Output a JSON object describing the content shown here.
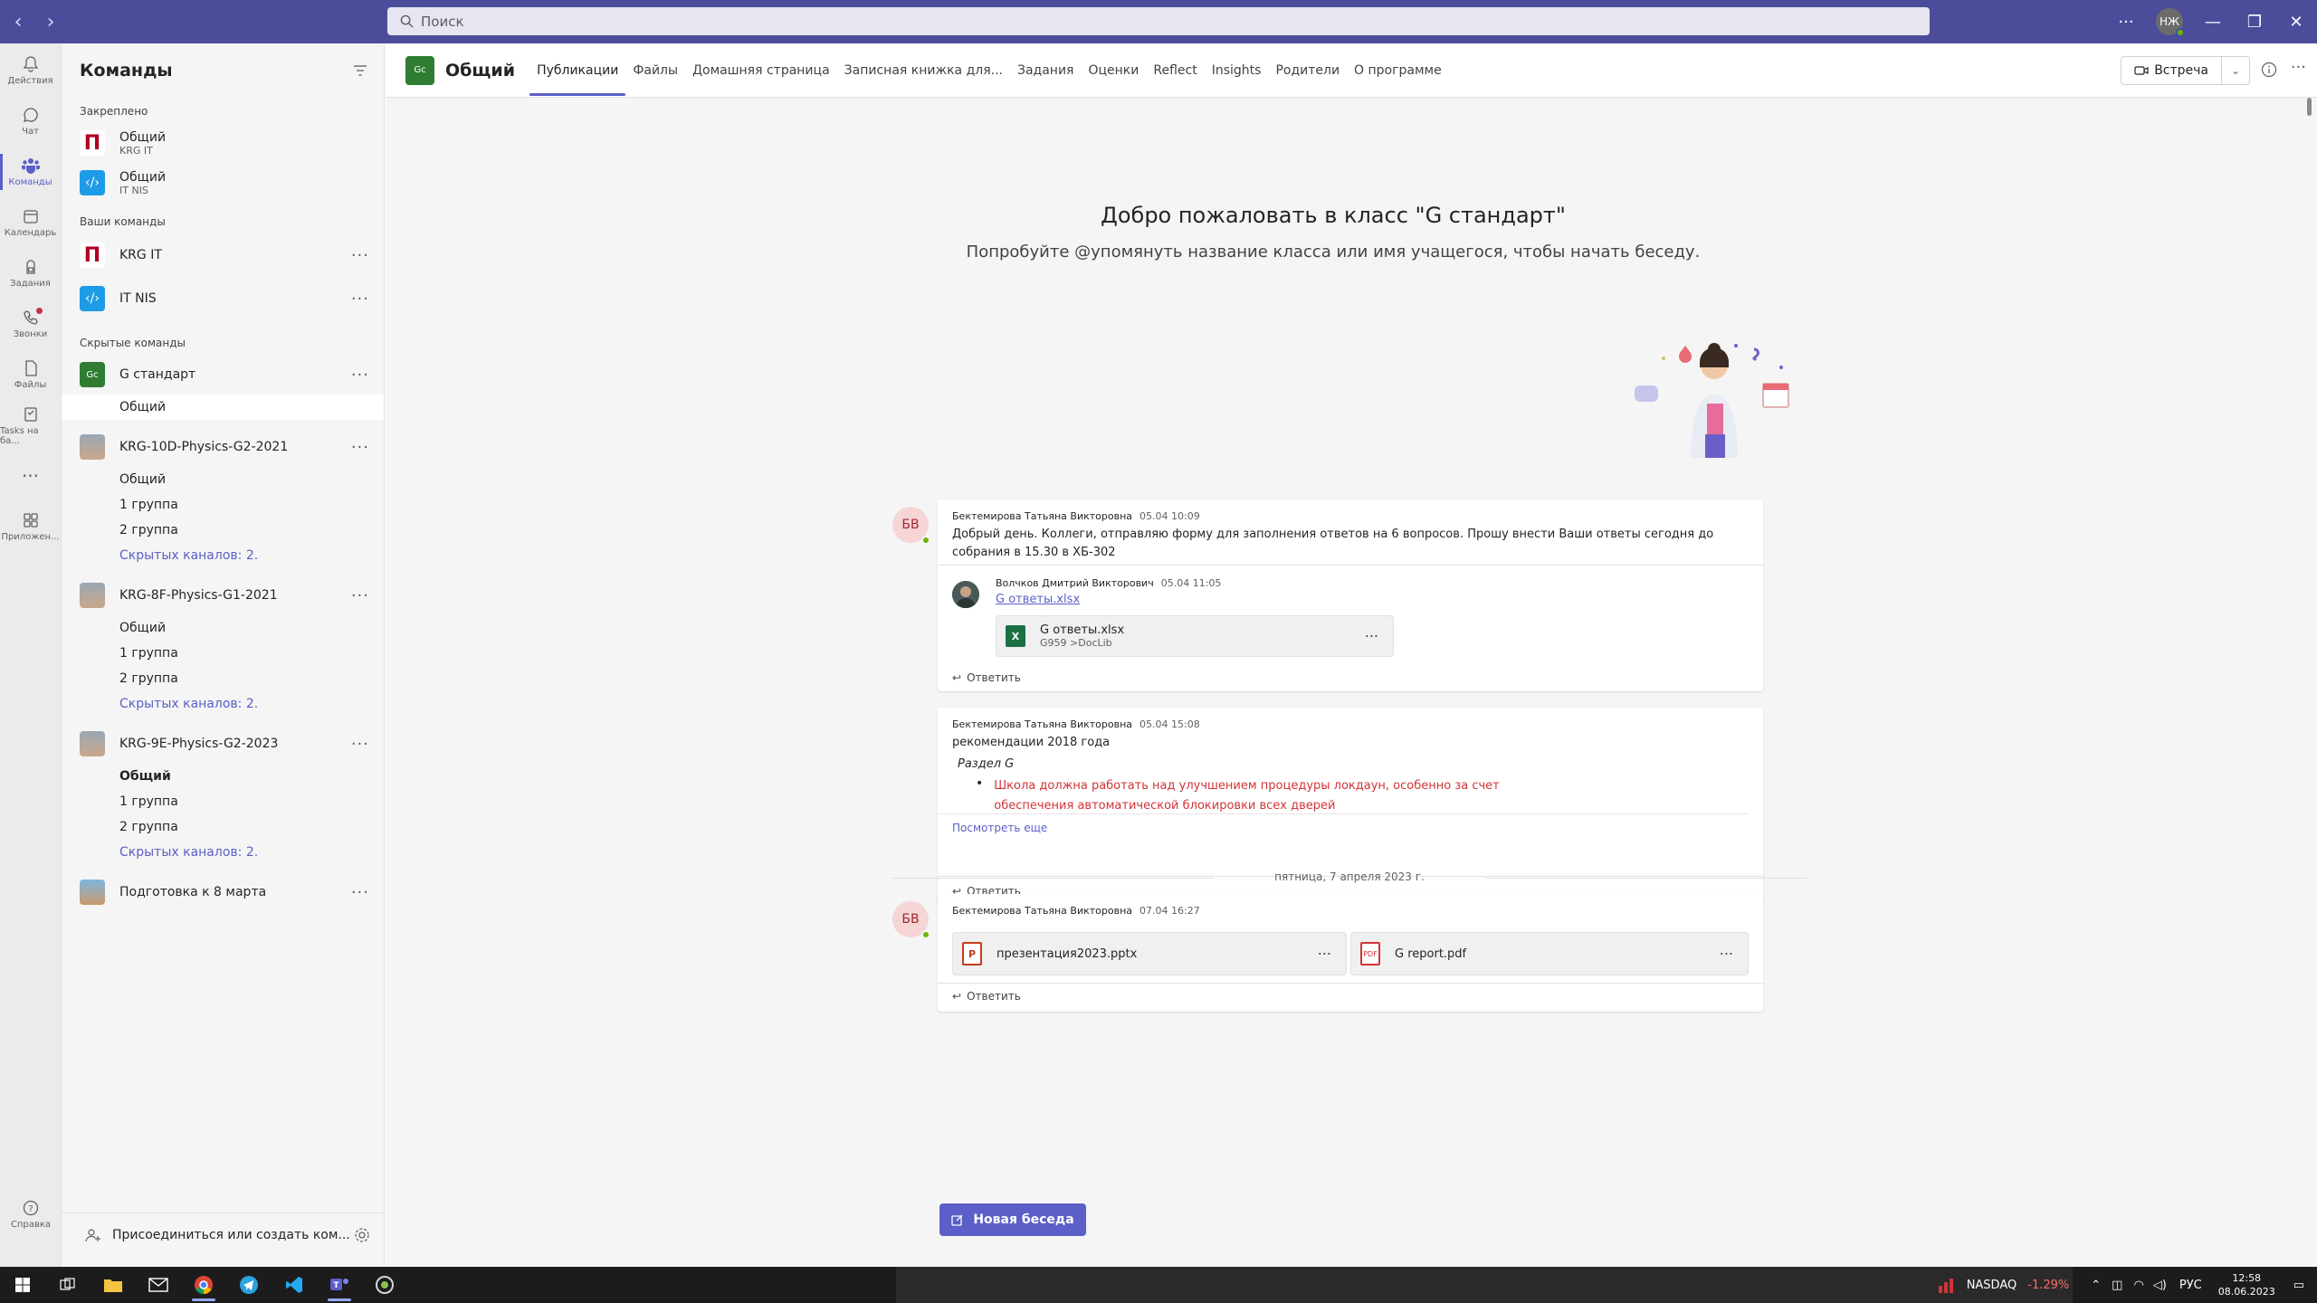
{
  "search": {
    "placeholder": "Поиск"
  },
  "user": {
    "initials": "НЖ"
  },
  "rail": [
    {
      "label": "Действия",
      "icon": "bell-icon"
    },
    {
      "label": "Чат",
      "icon": "chat-icon"
    },
    {
      "label": "Команды",
      "icon": "teams-icon"
    },
    {
      "label": "Календарь",
      "icon": "calendar-icon"
    },
    {
      "label": "Задания",
      "icon": "backpack-icon"
    },
    {
      "label": "Звонки",
      "icon": "phone-icon"
    },
    {
      "label": "Файлы",
      "icon": "file-icon"
    },
    {
      "label": "Tasks на ба...",
      "icon": "tasks-icon"
    },
    {
      "label": "Приложен...",
      "icon": "apps-icon"
    },
    {
      "label": "Справка",
      "icon": "help-icon"
    }
  ],
  "sidebar": {
    "title": "Команды",
    "pinned_label": "Закреплено",
    "pinned": [
      {
        "name": "Общий",
        "sub": "KRG IT"
      },
      {
        "name": "Общий",
        "sub": "IT NIS"
      }
    ],
    "your_label": "Ваши команды",
    "your": [
      {
        "name": "KRG IT"
      },
      {
        "name": "IT NIS"
      }
    ],
    "hidden_label": "Скрытые команды",
    "hidden": [
      {
        "name": "G стандарт",
        "logo": "Gс",
        "channels": [
          "Общий"
        ]
      },
      {
        "name": "KRG-10D-Physics-G2-2021",
        "channels": [
          "Общий",
          "1 группа",
          "2 группа"
        ],
        "hidden_link": "Скрытых каналов: 2."
      },
      {
        "name": "KRG-8F-Physics-G1-2021",
        "channels": [
          "Общий",
          "1 группа",
          "2 группа"
        ],
        "hidden_link": "Скрытых каналов: 2."
      },
      {
        "name": "KRG-9E-Physics-G2-2023",
        "channels": [
          "Общий",
          "1 группа",
          "2 группа"
        ],
        "hidden_link": "Скрытых каналов: 2."
      },
      {
        "name": "Подготовка к 8 марта"
      }
    ],
    "footer": "Присоединиться или создать ком..."
  },
  "channel": {
    "logo": "Gс",
    "title": "Общий",
    "tabs": [
      "Публикации",
      "Файлы",
      "Домашняя страница",
      "Записная книжка для...",
      "Задания",
      "Оценки",
      "Reflect",
      "Insights",
      "Родители",
      "О программе"
    ],
    "meet": "Встреча"
  },
  "welcome": {
    "title": "Добро пожаловать в класс \"G стандарт\"",
    "subtitle": "Попробуйте @упомянуть название класса или имя учащегося, чтобы начать беседу."
  },
  "posts": [
    {
      "avatar": "БВ",
      "author": "Бектемирова Татьяна Викторовна",
      "time": "05.04 10:09",
      "text": "Добрый день. Коллеги, отправляю форму для заполнения ответов на 6 вопросов. Прошу внести Ваши ответы сегодня до собрания в 15.30 в ХБ-302",
      "reply": {
        "author": "Волчков Дмитрий Викторович",
        "time": "05.04 11:05",
        "link": "G ответы.xlsx",
        "file": {
          "name": "G ответы.xlsx",
          "path": "G959",
          "sep": ">",
          "folder": "DocLib"
        }
      },
      "reply_label": "Ответить"
    },
    {
      "avatar": "БВ",
      "author": "Бектемирова Татьяна Викторовна",
      "time": "05.04 15:08",
      "text": "рекомендации 2018 года",
      "section": "Раздел G",
      "bullet": "Школа должна работать над улучшением процедуры локдаун, особенно за счет обеспечения автоматической блокировки всех дверей",
      "see_more": "Посмотреть еще",
      "reply_label": "Ответить"
    },
    {
      "avatar": "БВ",
      "author": "Бектемирова Татьяна Викторовна",
      "time": "07.04 16:27",
      "files": [
        {
          "name": "презентация2023.pptx",
          "icon": "P"
        },
        {
          "name": "G report.pdf",
          "icon": "PDF"
        }
      ],
      "reply_label": "Ответить"
    }
  ],
  "day_separator": "пятница, 7 апреля 2023 г.",
  "new_conversation": "Новая беседа",
  "taskbar": {
    "nasdaq": "NASDAQ",
    "nasdaq_change": "-1.29%",
    "lang": "РУС",
    "time": "12:58",
    "date": "08.06.2023"
  },
  "colors": {
    "accent": "#5b5fc7",
    "titlebar": "#4b4d9a",
    "bullet_red": "#d13438"
  }
}
